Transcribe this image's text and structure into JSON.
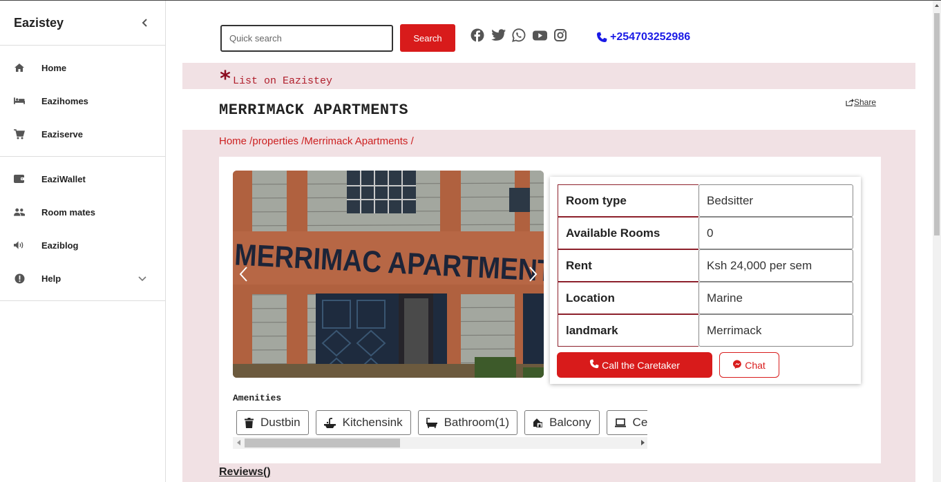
{
  "sidebar": {
    "title": "Eazistey",
    "items": [
      {
        "label": "Home",
        "icon": "home-icon"
      },
      {
        "label": "Eazihomes",
        "icon": "bed-icon"
      },
      {
        "label": "Eaziserve",
        "icon": "cart-icon"
      },
      {
        "label": "EaziWallet",
        "icon": "wallet-icon"
      },
      {
        "label": "Room mates",
        "icon": "users-icon"
      },
      {
        "label": "Eaziblog",
        "icon": "volume-icon"
      },
      {
        "label": "Help",
        "icon": "exclamation-icon"
      }
    ]
  },
  "header": {
    "search_placeholder": "Quick search",
    "search_button": "Search",
    "phone": "+254703252986",
    "socials": [
      "facebook-icon",
      "twitter-icon",
      "whatsapp-icon",
      "youtube-icon",
      "instagram-icon"
    ]
  },
  "list_banner": {
    "star": "*",
    "text": "List on Eazistey"
  },
  "property": {
    "title": "MERRIMACK APARTMENTS",
    "share": "Share",
    "breadcrumb": "Home /properties /Merrimack Apartments /",
    "photo_sign": "MERRIMAC APARTMENT",
    "details": [
      {
        "key": "Room type",
        "value": "Bedsitter"
      },
      {
        "key": "Available Rooms",
        "value": "0"
      },
      {
        "key": "Rent",
        "value": "Ksh 24,000 per sem"
      },
      {
        "key": "Location",
        "value": "Marine"
      },
      {
        "key": "landmark",
        "value": "Merrimack"
      }
    ],
    "call_button": "Call the Caretaker",
    "chat_button": "Chat"
  },
  "amenities": {
    "title": "Amenities",
    "items": [
      {
        "label": "Dustbin",
        "icon": "trash-icon"
      },
      {
        "label": "Kitchensink",
        "icon": "sink-icon"
      },
      {
        "label": "Bathroom(1)",
        "icon": "bathtub-icon"
      },
      {
        "label": "Balcony",
        "icon": "balcony-icon"
      },
      {
        "label": "Ce",
        "icon": "laptop-icon"
      }
    ]
  },
  "reviews_label": "Reviews()",
  "colors": {
    "accent": "#d81b1b",
    "banner_bg": "#f1e1e4",
    "phone": "#1a1ae6",
    "table_border": "#8c1f2a"
  }
}
